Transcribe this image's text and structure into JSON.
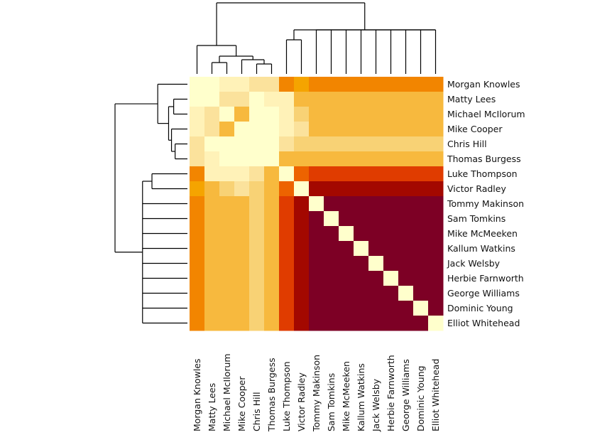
{
  "chart_data": {
    "type": "heatmap",
    "title": "",
    "xlabel": "",
    "ylabel": "",
    "row_labels": [
      "Morgan Knowles",
      "Matty Lees",
      "Michael McIlorum",
      "Mike Cooper",
      "Chris Hill",
      "Thomas Burgess",
      "Luke Thompson",
      "Victor Radley",
      "Tommy Makinson",
      "Sam Tomkins",
      "Mike McMeeken",
      "Kallum Watkins",
      "Jack Welsby",
      "Herbie Farnworth",
      "George Williams",
      "Dominic Young",
      "Elliot Whitehead"
    ],
    "col_labels": [
      "Morgan Knowles",
      "Matty Lees",
      "Michael McIlorum",
      "Mike Cooper",
      "Chris Hill",
      "Thomas Burgess",
      "Luke Thompson",
      "Victor Radley",
      "Tommy Makinson",
      "Sam Tomkins",
      "Mike McMeeken",
      "Kallum Watkins",
      "Jack Welsby",
      "Herbie Farnworth",
      "George Williams",
      "Dominic Young",
      "Elliot Whitehead"
    ],
    "colormap": [
      "#ffffcc",
      "#fff2b8",
      "#fbe29c",
      "#f8d275",
      "#f7b93e",
      "#f5a400",
      "#f28500",
      "#ed6300",
      "#e03c00",
      "#a30800",
      "#7d0025"
    ],
    "value_scale_note": "cell values are ordinal color levels 0 (lightest) to 10 (darkest)",
    "values": [
      [
        0,
        0,
        1,
        1,
        2,
        2,
        6,
        5,
        6,
        6,
        6,
        6,
        6,
        6,
        6,
        6,
        6
      ],
      [
        0,
        0,
        2,
        2,
        0,
        1,
        1,
        4,
        4,
        4,
        4,
        4,
        4,
        4,
        4,
        4,
        4
      ],
      [
        1,
        2,
        0,
        4,
        0,
        0,
        1,
        3,
        4,
        4,
        4,
        4,
        4,
        4,
        4,
        4,
        4
      ],
      [
        1,
        2,
        4,
        0,
        0,
        0,
        1,
        2,
        4,
        4,
        4,
        4,
        4,
        4,
        4,
        4,
        4
      ],
      [
        2,
        0,
        0,
        0,
        0,
        0,
        2,
        3,
        3,
        3,
        3,
        3,
        3,
        3,
        3,
        3,
        3
      ],
      [
        2,
        1,
        0,
        0,
        0,
        0,
        4,
        4,
        4,
        4,
        4,
        4,
        4,
        4,
        4,
        4,
        4
      ],
      [
        6,
        1,
        1,
        1,
        2,
        4,
        0,
        7,
        8,
        8,
        8,
        8,
        8,
        8,
        8,
        8,
        8
      ],
      [
        5,
        4,
        3,
        2,
        3,
        4,
        7,
        0,
        9,
        9,
        9,
        9,
        9,
        9,
        9,
        9,
        9
      ],
      [
        6,
        4,
        4,
        4,
        3,
        4,
        8,
        9,
        0,
        10,
        10,
        10,
        10,
        10,
        10,
        10,
        10
      ],
      [
        6,
        4,
        4,
        4,
        3,
        4,
        8,
        9,
        10,
        0,
        10,
        10,
        10,
        10,
        10,
        10,
        10
      ],
      [
        6,
        4,
        4,
        4,
        3,
        4,
        8,
        9,
        10,
        10,
        0,
        10,
        10,
        10,
        10,
        10,
        10
      ],
      [
        6,
        4,
        4,
        4,
        3,
        4,
        8,
        9,
        10,
        10,
        10,
        0,
        10,
        10,
        10,
        10,
        10
      ],
      [
        6,
        4,
        4,
        4,
        3,
        4,
        8,
        9,
        10,
        10,
        10,
        10,
        0,
        10,
        10,
        10,
        10
      ],
      [
        6,
        4,
        4,
        4,
        3,
        4,
        8,
        9,
        10,
        10,
        10,
        10,
        10,
        0,
        10,
        10,
        10
      ],
      [
        6,
        4,
        4,
        4,
        3,
        4,
        8,
        9,
        10,
        10,
        10,
        10,
        10,
        10,
        0,
        10,
        10
      ],
      [
        6,
        4,
        4,
        4,
        3,
        4,
        8,
        9,
        10,
        10,
        10,
        10,
        10,
        10,
        10,
        0,
        10
      ],
      [
        6,
        4,
        4,
        4,
        3,
        4,
        8,
        9,
        10,
        10,
        10,
        10,
        10,
        10,
        10,
        10,
        0
      ]
    ],
    "dendrogram_top": {
      "merges": [
        {
          "left": [
            1
          ],
          "right": [
            2
          ],
          "height": 0.16
        },
        {
          "left": [
            4
          ],
          "right": [
            5
          ],
          "height": 0.14
        },
        {
          "left": [
            3
          ],
          "right": [
            4,
            5
          ],
          "height": 0.2
        },
        {
          "left": [
            1,
            2
          ],
          "right": [
            3,
            4,
            5
          ],
          "height": 0.25
        },
        {
          "left": [
            0
          ],
          "right": [
            1,
            2,
            3,
            4,
            5
          ],
          "height": 0.4
        },
        {
          "left": [
            6
          ],
          "right": [
            7
          ],
          "height": 0.48
        },
        {
          "left": [
            8
          ],
          "right": [
            9,
            10,
            11,
            12,
            13,
            14,
            15,
            16
          ],
          "height": 0.62,
          "flat": true
        },
        {
          "left": [
            6,
            7
          ],
          "right": [
            8,
            9,
            10,
            11,
            12,
            13,
            14,
            15,
            16
          ],
          "height": 0.62
        },
        {
          "left": [
            0,
            1,
            2,
            3,
            4,
            5
          ],
          "right": [
            6,
            7,
            8,
            9,
            10,
            11,
            12,
            13,
            14,
            15,
            16
          ],
          "height": 1.0
        }
      ]
    },
    "dendrogram_left": {
      "merges": [
        {
          "left": [
            1
          ],
          "right": [
            2
          ],
          "height": 0.19
        },
        {
          "left": [
            4
          ],
          "right": [
            5
          ],
          "height": 0.17
        },
        {
          "left": [
            3
          ],
          "right": [
            4,
            5
          ],
          "height": 0.22
        },
        {
          "left": [
            1,
            2
          ],
          "right": [
            3,
            4,
            5
          ],
          "height": 0.26
        },
        {
          "left": [
            0
          ],
          "right": [
            1,
            2,
            3,
            4,
            5
          ],
          "height": 0.41
        },
        {
          "left": [
            6
          ],
          "right": [
            7
          ],
          "height": 0.49
        },
        {
          "left": [
            6,
            7
          ],
          "right": [
            8,
            9,
            10,
            11,
            12,
            13,
            14,
            15,
            16
          ],
          "height": 0.62,
          "flat_right": true
        },
        {
          "left": [
            0,
            1,
            2,
            3,
            4,
            5
          ],
          "right": [
            6,
            7,
            8,
            9,
            10,
            11,
            12,
            13,
            14,
            15,
            16
          ],
          "height": 1.0
        }
      ]
    }
  }
}
